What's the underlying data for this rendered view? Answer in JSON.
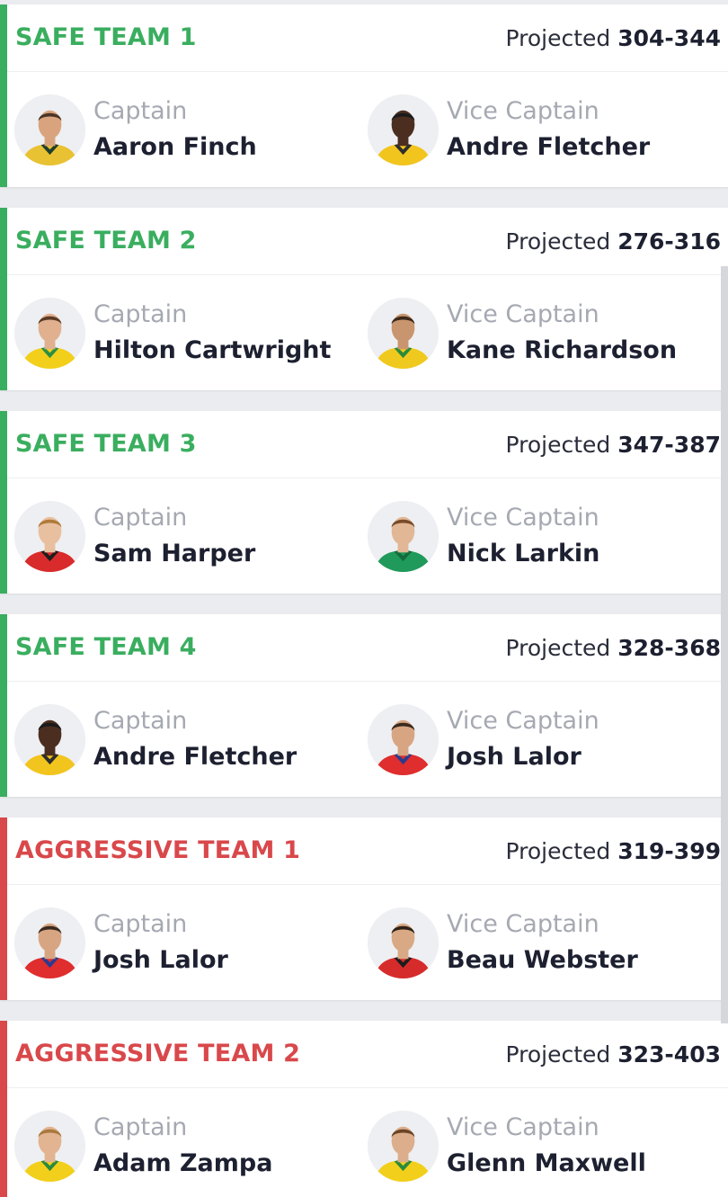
{
  "labels": {
    "projected": "Projected",
    "captain": "Captain",
    "vice_captain": "Vice Captain"
  },
  "colors": {
    "safe": "#3aae5f",
    "aggressive": "#d9484b"
  },
  "teams": [
    {
      "name": "SAFE TEAM 1",
      "type": "safe",
      "projected": "304-344",
      "captain": {
        "name": "Aaron Finch",
        "kit": "#e9c233",
        "kit2": "#1f3f2e",
        "skin": "#d9a47d",
        "hair": "#4a3528"
      },
      "vice_captain": {
        "name": "Andre Fletcher",
        "kit": "#f2c51e",
        "kit2": "#2e2e2e",
        "skin": "#4b2e20",
        "hair": "#1b1b1b"
      }
    },
    {
      "name": "SAFE TEAM 2",
      "type": "safe",
      "projected": "276-316",
      "captain": {
        "name": "Hilton Cartwright",
        "kit": "#f2cf1a",
        "kit2": "#2b8f45",
        "skin": "#e0b08f",
        "hair": "#5a3b25"
      },
      "vice_captain": {
        "name": "Kane Richardson",
        "kit": "#f0c91e",
        "kit2": "#2a8a3b",
        "skin": "#c9956e",
        "hair": "#3b2a1c"
      }
    },
    {
      "name": "SAFE TEAM 3",
      "type": "safe",
      "projected": "347-387",
      "captain": {
        "name": "Sam Harper",
        "kit": "#d92b2b",
        "kit2": "#1c1c1c",
        "skin": "#e8c0a0",
        "hair": "#b07a3a"
      },
      "vice_captain": {
        "name": "Nick Larkin",
        "kit": "#1f9a5a",
        "kit2": "#146b3d",
        "skin": "#e1b796",
        "hair": "#7a4b2a"
      }
    },
    {
      "name": "SAFE TEAM 4",
      "type": "safe",
      "projected": "328-368",
      "captain": {
        "name": "Andre Fletcher",
        "kit": "#f2c51e",
        "kit2": "#2e2e2e",
        "skin": "#4b2e20",
        "hair": "#1b1b1b"
      },
      "vice_captain": {
        "name": "Josh Lalor",
        "kit": "#e02d2d",
        "kit2": "#2b3a8f",
        "skin": "#d8a583",
        "hair": "#3a2a1e"
      }
    },
    {
      "name": "AGGRESSIVE TEAM 1",
      "type": "aggressive",
      "projected": "319-399",
      "captain": {
        "name": "Josh Lalor",
        "kit": "#e02d2d",
        "kit2": "#2b3a8f",
        "skin": "#d8a583",
        "hair": "#3a2a1e"
      },
      "vice_captain": {
        "name": "Beau Webster",
        "kit": "#d62b2b",
        "kit2": "#1c1c1c",
        "skin": "#d9a985",
        "hair": "#2f2117"
      }
    },
    {
      "name": "AGGRESSIVE TEAM 2",
      "type": "aggressive",
      "projected": "323-403",
      "captain": {
        "name": "Adam Zampa",
        "kit": "#f2cf1a",
        "kit2": "#2a8a3b",
        "skin": "#e2b491",
        "hair": "#a9783d"
      },
      "vice_captain": {
        "name": "Glenn Maxwell",
        "kit": "#f2cf1a",
        "kit2": "#2a8a3b",
        "skin": "#dcae8c",
        "hair": "#6a4526"
      }
    }
  ]
}
